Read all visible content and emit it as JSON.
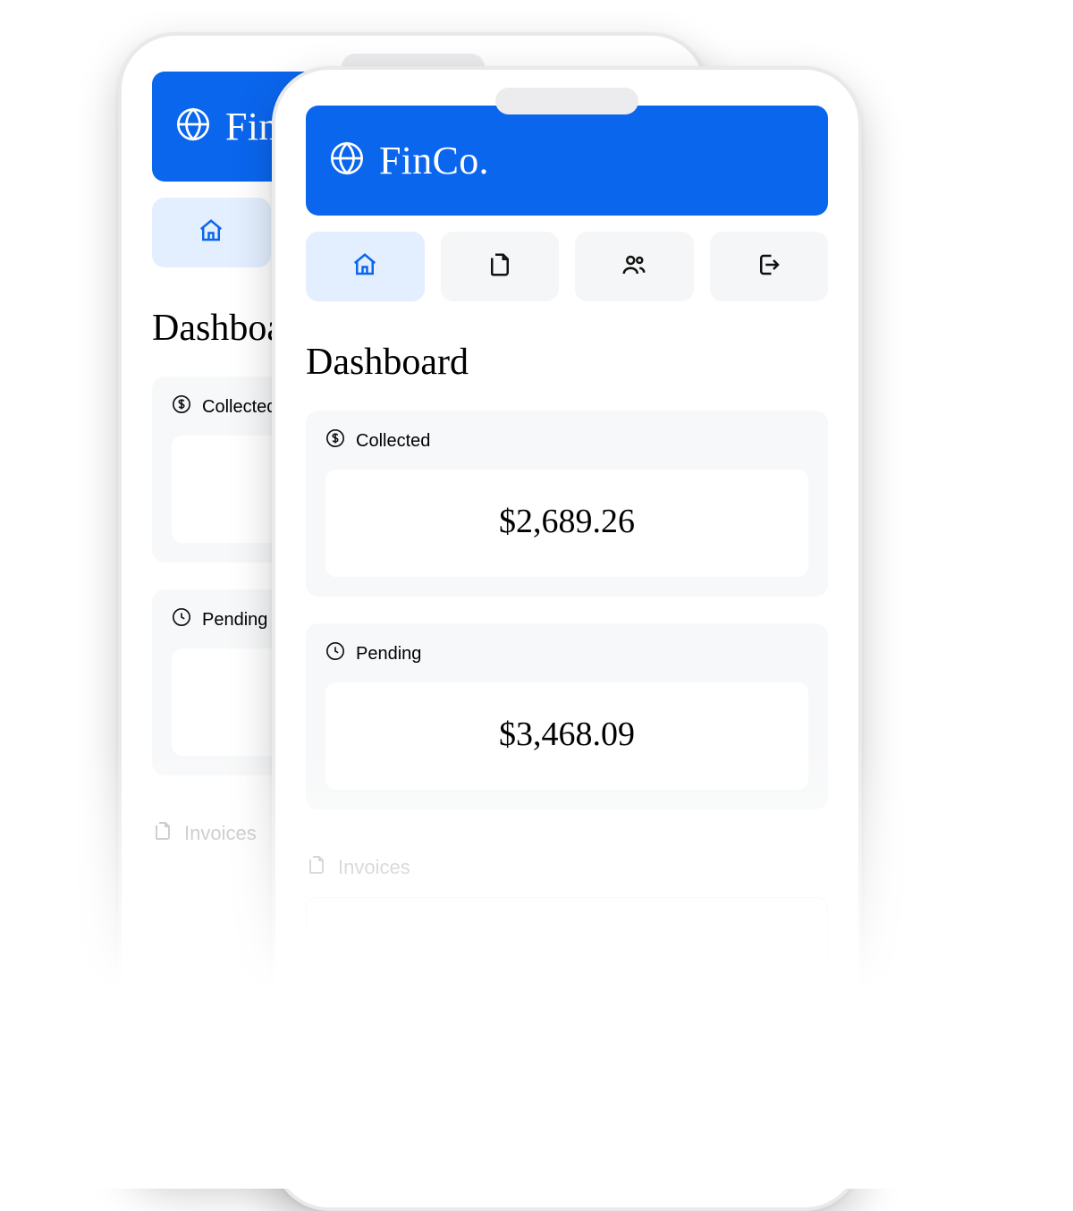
{
  "brand": {
    "name": "FinCo."
  },
  "nav": {
    "items": [
      {
        "id": "home",
        "icon": "home-icon",
        "active": true
      },
      {
        "id": "documents",
        "icon": "documents-icon",
        "active": false
      },
      {
        "id": "customers",
        "icon": "users-icon",
        "active": false
      },
      {
        "id": "signout",
        "icon": "signout-icon",
        "active": false
      }
    ]
  },
  "page": {
    "title": "Dashboard"
  },
  "cards": {
    "collected": {
      "label": "Collected",
      "value": "$2,689.26"
    },
    "pending": {
      "label": "Pending",
      "value": "$3,468.09"
    }
  },
  "sections": {
    "invoices_label": "Invoices"
  },
  "colors": {
    "accent": "#0b66ee",
    "tab_bg": "#f5f6f7",
    "tab_active_bg": "#e3efff",
    "card_bg": "#f7f8f9"
  }
}
